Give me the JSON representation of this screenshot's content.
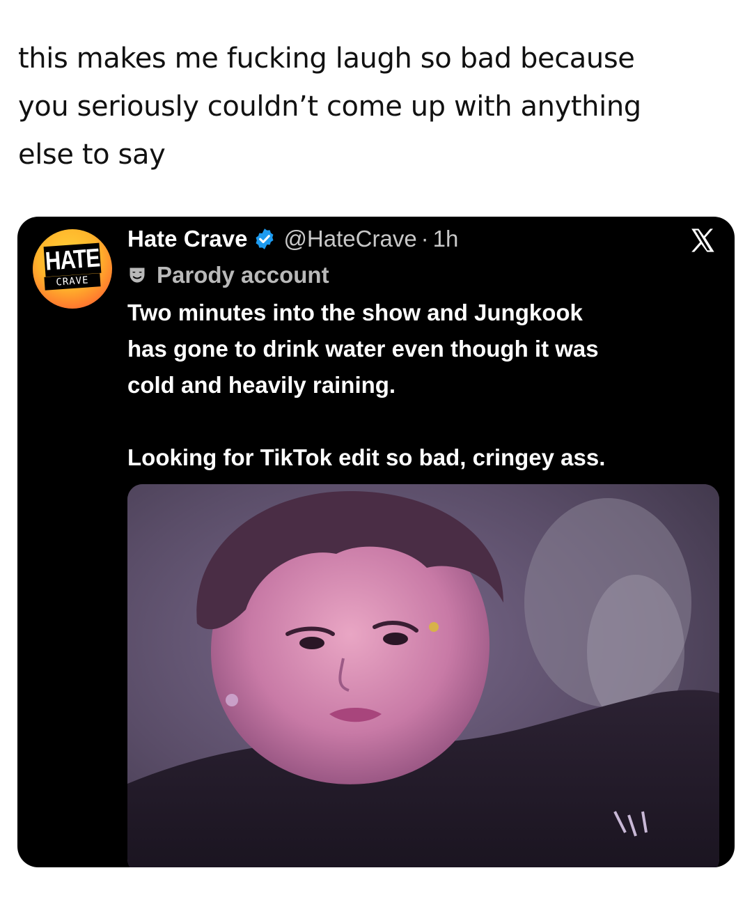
{
  "caption": {
    "line1": "this makes me fucking laugh so bad because",
    "line2": "you seriously couldn’t come up with anything",
    "line3": "else to say"
  },
  "tweet": {
    "avatar_logo": {
      "top": "HATE",
      "bottom": "CRAVE"
    },
    "display_name": "Hate Crave",
    "handle": "@HateCrave",
    "separator": "·",
    "time": "1h",
    "account_label": "Parody account",
    "body": {
      "paragraph1_line1": "Two minutes into the show and Jungkook",
      "paragraph1_line2": "has gone to drink water even though it was",
      "paragraph1_line3": "cold and heavily raining.",
      "paragraph2": "Looking for TikTok edit so bad, cringey ass."
    },
    "icons": {
      "verified": "verified-badge-icon",
      "platform": "x-logo-icon",
      "parody": "mask-icon"
    },
    "colors": {
      "card_bg": "#000000",
      "verified_blue": "#1d9bf0",
      "secondary_text": "#c8c8c8"
    },
    "media": {
      "kind": "photo"
    }
  }
}
